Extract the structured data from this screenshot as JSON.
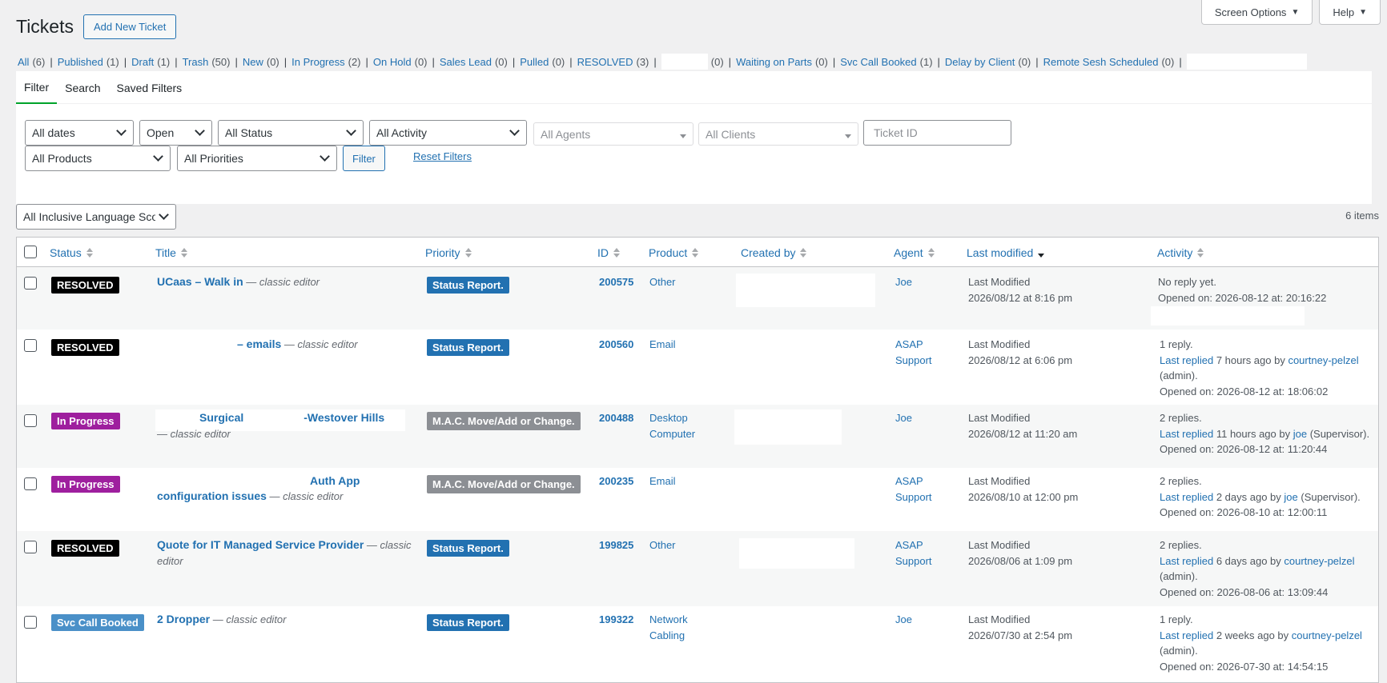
{
  "screen_meta": {
    "screen_options": "Screen Options",
    "help": "Help"
  },
  "header": {
    "title": "Tickets",
    "add_new": "Add New Ticket"
  },
  "status_links": [
    {
      "label": "All",
      "count": "(6)"
    },
    {
      "label": "Published",
      "count": "(1)"
    },
    {
      "label": "Draft",
      "count": "(1)"
    },
    {
      "label": "Trash",
      "count": "(50)"
    },
    {
      "label": "New",
      "count": "(0)"
    },
    {
      "label": "In Progress",
      "count": "(2)"
    },
    {
      "label": "On Hold",
      "count": "(0)"
    },
    {
      "label": "Sales Lead",
      "count": "(0)"
    },
    {
      "label": "Pulled",
      "count": "(0)"
    },
    {
      "label": "RESOLVED",
      "count": "(3)"
    },
    {
      "label": "",
      "count": "(0)"
    },
    {
      "label": "Waiting on Parts",
      "count": "(0)"
    },
    {
      "label": "Svc Call Booked",
      "count": "(1)"
    },
    {
      "label": "Delay by Client",
      "count": "(0)"
    },
    {
      "label": "Remote Sesh Scheduled",
      "count": "(0)"
    }
  ],
  "tabs": [
    "Filter",
    "Search",
    "Saved Filters"
  ],
  "filters": {
    "dates": "All dates",
    "state": "Open",
    "status": "All Status",
    "activity": "All Activity",
    "agents": "All Agents",
    "clients": "All Clients",
    "ticket_id_placeholder": "Ticket ID",
    "products": "All Products",
    "priorities": "All Priorities",
    "filter_button": "Filter",
    "reset": "Reset Filters"
  },
  "language_filter": "All Inclusive Language Scor",
  "items_count": "6 items",
  "columns": {
    "status": "Status",
    "title": "Title",
    "priority": "Priority",
    "id": "ID",
    "product": "Product",
    "created_by": "Created by",
    "agent": "Agent",
    "last_modified": "Last modified",
    "activity": "Activity"
  },
  "rows": [
    {
      "status": "RESOLVED",
      "status_color": "#000000",
      "title": "UCaas – Walk in",
      "title_suffix": " — classic editor",
      "title_l2": "",
      "suffix_l2": "",
      "priority": "Status Report.",
      "priority_color": "#2271b1",
      "id": "200575",
      "product_l1": "Other",
      "product_l2": "",
      "agent_l1": "Joe",
      "agent_l2": "",
      "lm_l1": "Last Modified",
      "lm_l2": "2026/08/12 at 8:16 pm",
      "act_l1": "No reply yet.",
      "act_link": "",
      "act_mid": "",
      "act_user": "",
      "act_role": "",
      "act_role2": "",
      "act_opened": "Opened on: 2026-08-12 at: 20:16:22"
    },
    {
      "status": "RESOLVED",
      "status_color": "#000000",
      "title": "– emails",
      "title_suffix": " — classic editor",
      "title_l2": "",
      "suffix_l2": "",
      "priority": "Status Report.",
      "priority_color": "#2271b1",
      "id": "200560",
      "product_l1": "Email",
      "product_l2": "",
      "agent_l1": "ASAP",
      "agent_l2": "Support",
      "lm_l1": "Last Modified",
      "lm_l2": "2026/08/12 at 6:06 pm",
      "act_l1": "1 reply.",
      "act_link": "Last replied",
      "act_mid": " 7 hours ago by ",
      "act_user": "courtney-pelzel",
      "act_role": "",
      "act_role2": "(admin).",
      "act_opened": "Opened on: 2026-08-12 at: 18:06:02"
    },
    {
      "status": "In Progress",
      "status_color": "#9e1f9e",
      "title": "Surgical",
      "title_b": "-Westover Hills",
      "title_suffix": "",
      "title_l2": "",
      "suffix_l2": "— classic editor",
      "priority": "M.A.C. Move/Add or Change.",
      "priority_color": "#8c8f94",
      "id": "200488",
      "product_l1": "Desktop",
      "product_l2": "Computer",
      "agent_l1": "Joe",
      "agent_l2": "",
      "lm_l1": "Last Modified",
      "lm_l2": "2026/08/12 at 11:20 am",
      "act_l1": "2 replies.",
      "act_link": "Last replied",
      "act_mid": " 11 hours ago by ",
      "act_user": "joe",
      "act_role": " (Supervisor).",
      "act_role2": "",
      "act_opened": "Opened on: 2026-08-12 at: 11:20:44"
    },
    {
      "status": "In Progress",
      "status_color": "#9e1f9e",
      "title": "Auth App",
      "title_suffix": "",
      "title_l2": "configuration issues",
      "suffix_l2": " — classic editor",
      "priority": "M.A.C. Move/Add or Change.",
      "priority_color": "#8c8f94",
      "id": "200235",
      "product_l1": "Email",
      "product_l2": "",
      "agent_l1": "ASAP",
      "agent_l2": "Support",
      "lm_l1": "Last Modified",
      "lm_l2": "2026/08/10 at 12:00 pm",
      "act_l1": "2 replies.",
      "act_link": "Last replied",
      "act_mid": " 2 days ago by ",
      "act_user": "joe",
      "act_role": " (Supervisor).",
      "act_role2": "",
      "act_opened": "Opened on: 2026-08-10 at: 12:00:11"
    },
    {
      "status": "RESOLVED",
      "status_color": "#000000",
      "title": "Quote for IT Managed Service Provider",
      "title_suffix": " — classic",
      "title_l2": "",
      "suffix_l2": "editor",
      "priority": "Status Report.",
      "priority_color": "#2271b1",
      "id": "199825",
      "product_l1": "Other",
      "product_l2": "",
      "agent_l1": "ASAP",
      "agent_l2": "Support",
      "lm_l1": "Last Modified",
      "lm_l2": "2026/08/06 at 1:09 pm",
      "act_l1": "2 replies.",
      "act_link": "Last replied",
      "act_mid": " 6 days ago by ",
      "act_user": "courtney-pelzel",
      "act_role": "",
      "act_role2": "(admin).",
      "act_opened": "Opened on: 2026-08-06 at: 13:09:44"
    },
    {
      "status": "Svc Call Booked",
      "status_color": "#4a90c8",
      "title": "2 Dropper",
      "title_suffix": " — classic editor",
      "title_l2": "",
      "suffix_l2": "",
      "priority": "Status Report.",
      "priority_color": "#2271b1",
      "id": "199322",
      "product_l1": "Network",
      "product_l2": "Cabling",
      "agent_l1": "Joe",
      "agent_l2": "",
      "lm_l1": "Last Modified",
      "lm_l2": "2026/07/30 at 2:54 pm",
      "act_l1": "1 reply.",
      "act_link": "Last replied",
      "act_mid": " 2 weeks ago by ",
      "act_user": "courtney-pelzel",
      "act_role": "",
      "act_role2": "(admin).",
      "act_opened": "Opened on: 2026-07-30 at: 14:54:15"
    }
  ]
}
